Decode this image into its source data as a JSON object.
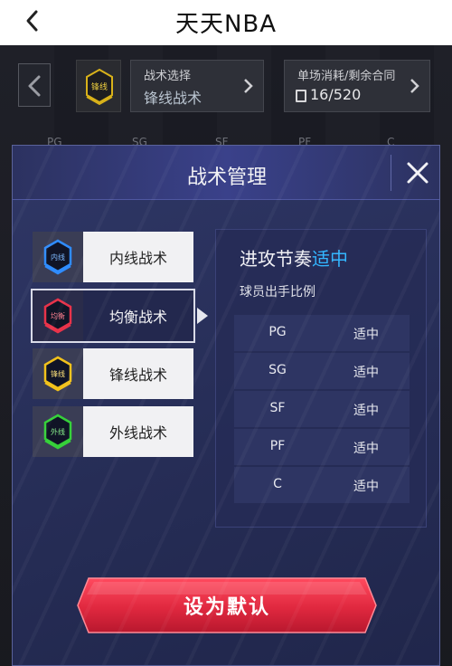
{
  "app": {
    "title": "天天NBA"
  },
  "topbar": {
    "tactic_badge_text": "锋线",
    "tactic_select_label": "战术选择",
    "tactic_select_value": "锋线战术",
    "cost_label": "单场消耗/剩余合同",
    "cost_value": "16/520"
  },
  "positions": [
    "PG",
    "SG",
    "SF",
    "PF",
    "C"
  ],
  "modal": {
    "title": "战术管理",
    "tactics": [
      {
        "label": "内线战术",
        "badge": "内线",
        "color": "#2f8cff",
        "selected": false
      },
      {
        "label": "均衡战术",
        "badge": "均衡",
        "color": "#e8334a",
        "selected": true
      },
      {
        "label": "锋线战术",
        "badge": "锋线",
        "color": "#f2c21b",
        "selected": false
      },
      {
        "label": "外线战术",
        "badge": "外线",
        "color": "#36d13a",
        "selected": false
      }
    ],
    "info": {
      "pace_label": "进攻节奏",
      "pace_value": "适中",
      "ratio_label": "球员出手比例",
      "rows": [
        {
          "pos": "PG",
          "level": "适中"
        },
        {
          "pos": "SG",
          "level": "适中"
        },
        {
          "pos": "SF",
          "level": "适中"
        },
        {
          "pos": "PF",
          "level": "适中"
        },
        {
          "pos": "C",
          "level": "适中"
        }
      ]
    },
    "set_default_label": "设为默认"
  },
  "colors": {
    "accent_blue": "#33b6ff",
    "button_red": "#e0283f",
    "modal_bg": "#2a3160"
  }
}
